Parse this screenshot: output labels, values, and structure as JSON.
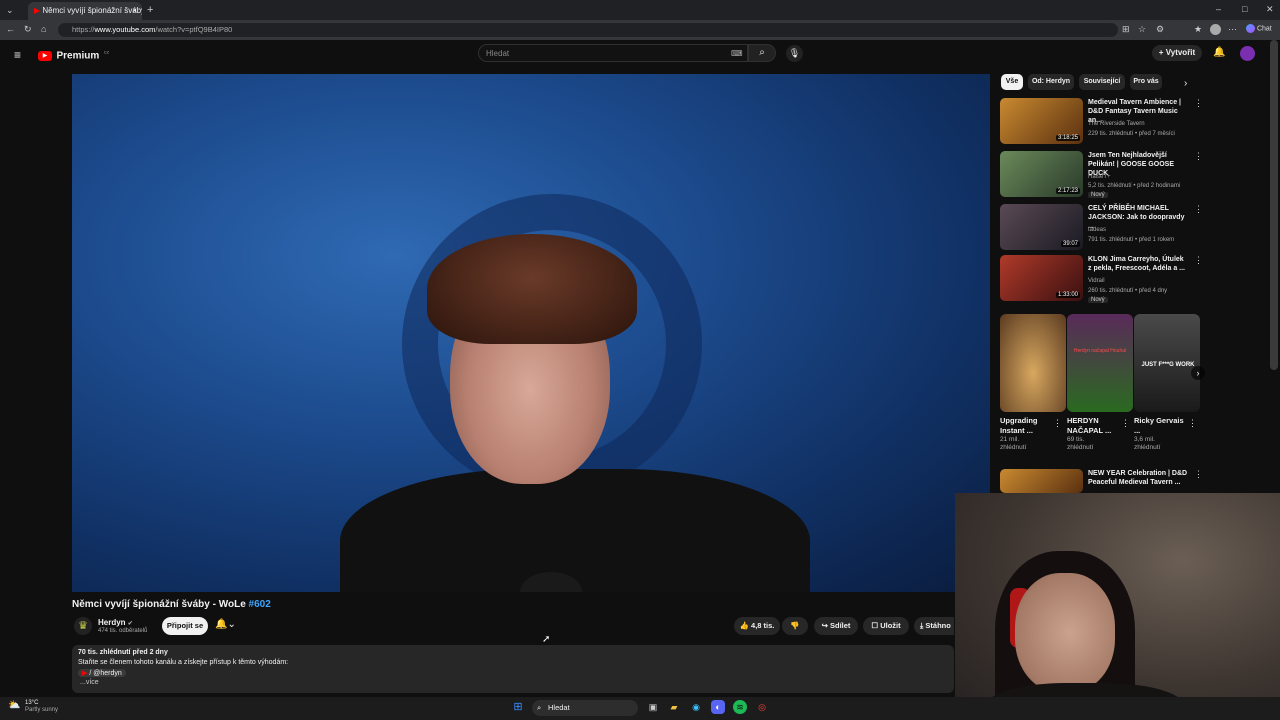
{
  "browser": {
    "tab_title": "Němci vyvíjí špionážní šváby",
    "url_prefix": "https://",
    "url_domain": "www.youtube.com",
    "url_path": "/watch?v=ptfQ9B4IP80",
    "chat_label": "Chat"
  },
  "header": {
    "logo": "Premium",
    "logo_sup": "CZ",
    "search_placeholder": "Hledat",
    "create_label": "Vytvořit"
  },
  "video": {
    "title": "Němci vyvíjí špionážní šváby - WoLe",
    "title_hashtag": "#602",
    "channel_name": "Herdyn",
    "subscribers": "474 tis. odběratelů",
    "join_label": "Připojit se",
    "likes": "4,8 tis.",
    "share_label": "Sdílet",
    "save_label": "Uložit",
    "download_label": "Stáhno"
  },
  "description": {
    "stats": "70 tis. zhlédnutí  před 2 dny",
    "line1": "Staňte se členem tohoto kanálu a získejte přístup k těmto výhodám:",
    "handle": "/ @herdyn",
    "more": "...více"
  },
  "chips": [
    "Vše",
    "Od: Herdyn",
    "Související",
    "Pro vás"
  ],
  "recommendations": [
    {
      "title": "Medieval Tavern Ambience | D&D Fantasy Tavern Music an...",
      "channel": "The Riverside Tavern",
      "meta": "229 tis. zhlédnutí • před 7 měsíci",
      "duration": "3:18:25",
      "badge": "",
      "color": "#8a5a20"
    },
    {
      "title": "Jsem Ten Nejhladovější Pelikán! | GOOSE GOOSE DUCK",
      "channel": "HaiseT+",
      "meta": "5,2 tis. zhlédnutí • před 2 hodinami",
      "duration": "2:17:23",
      "badge": "Nový",
      "color": "#4a6a3a"
    },
    {
      "title": "CELÝ PŘÍBĚH MICHAEL JACKSON: Jak to doopravdy ...",
      "channel": "tadeas",
      "meta": "791 tis. zhlédnutí • před 1 rokem",
      "duration": "39:07",
      "badge": "",
      "color": "#3a3340"
    },
    {
      "title": "KLON Jima Carreyho, Útulek z pekla, Freescoot, Adéla a ...",
      "channel": "Vidrail",
      "meta": "260 tis. zhlédnutí • před 4 dny",
      "duration": "1:33:00",
      "badge": "Nový",
      "color": "#7a2a1e"
    }
  ],
  "shorts": [
    {
      "title": "Upgrading Instant ...",
      "views": "21 mil.",
      "views2": "zhlédnutí",
      "color": "#8a6a40",
      "overlay": ""
    },
    {
      "title": "HERDYN NAČAPAL ...",
      "views": "69 tis.",
      "views2": "zhlédnutí",
      "color": "#3a6a2a",
      "overlay": "Herdyn načapal Houhal"
    },
    {
      "title": "Ricky Gervais ...",
      "views": "3,6 mil.",
      "views2": "zhlédnutí",
      "color": "#3a3a3a",
      "overlay": "JUST F***G WORK"
    }
  ],
  "rec_last": {
    "title": "NEW YEAR Celebration | D&D Peaceful Medieval Tavern ...",
    "color": "#8a5a20"
  },
  "taskbar": {
    "weather_temp": "13°C",
    "weather_desc": "Partly sunny",
    "search_label": "Hledat"
  }
}
